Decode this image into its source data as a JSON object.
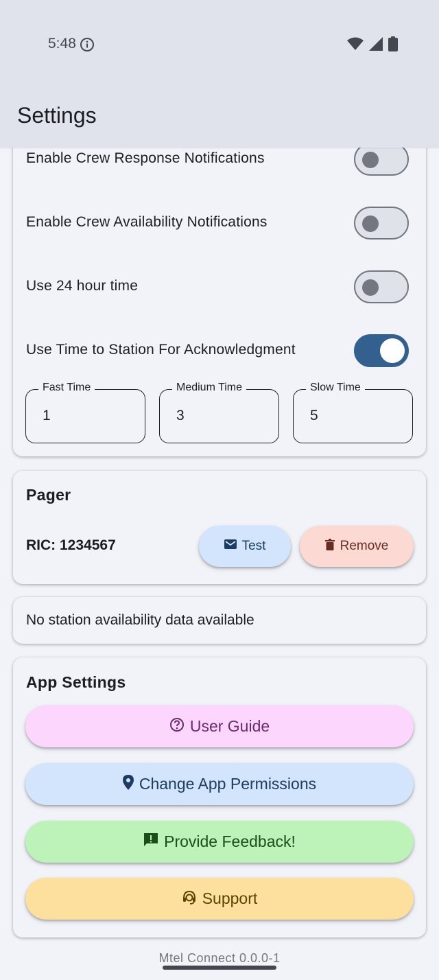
{
  "status_bar": {
    "time": "5:48"
  },
  "app_bar": {
    "title": "Settings"
  },
  "notifications": {
    "items": [
      {
        "label": "Enable Crew Response Notifications",
        "on": false
      },
      {
        "label": "Enable Crew Availability Notifications",
        "on": false
      },
      {
        "label": "Use 24 hour time",
        "on": false
      },
      {
        "label": "Use Time to Station For Acknowledgment",
        "on": true
      }
    ],
    "fields": [
      {
        "label": "Fast Time",
        "value": "1"
      },
      {
        "label": "Medium Time",
        "value": "3"
      },
      {
        "label": "Slow Time",
        "value": "5"
      }
    ]
  },
  "pager": {
    "title": "Pager",
    "ric": "RIC: 1234567",
    "test_label": "Test",
    "remove_label": "Remove"
  },
  "station": {
    "message": "No station availability data available"
  },
  "app_settings": {
    "title": "App Settings",
    "buttons": [
      {
        "label": "User Guide",
        "icon": "help-circle-icon"
      },
      {
        "label": "Change App Permissions",
        "icon": "location-pin-icon"
      },
      {
        "label": "Provide Feedback!",
        "icon": "feedback-icon"
      },
      {
        "label": "Support",
        "icon": "support-agent-icon"
      }
    ]
  },
  "footer": {
    "version": "Mtel Connect 0.0.0-1"
  },
  "colors": {
    "toggle_on": "#33608f",
    "guide": "#fdd6fe",
    "permissions": "#d3e4fd",
    "feedback": "#bdf2b8",
    "support": "#fde09e",
    "remove": "#fdd9d3"
  }
}
